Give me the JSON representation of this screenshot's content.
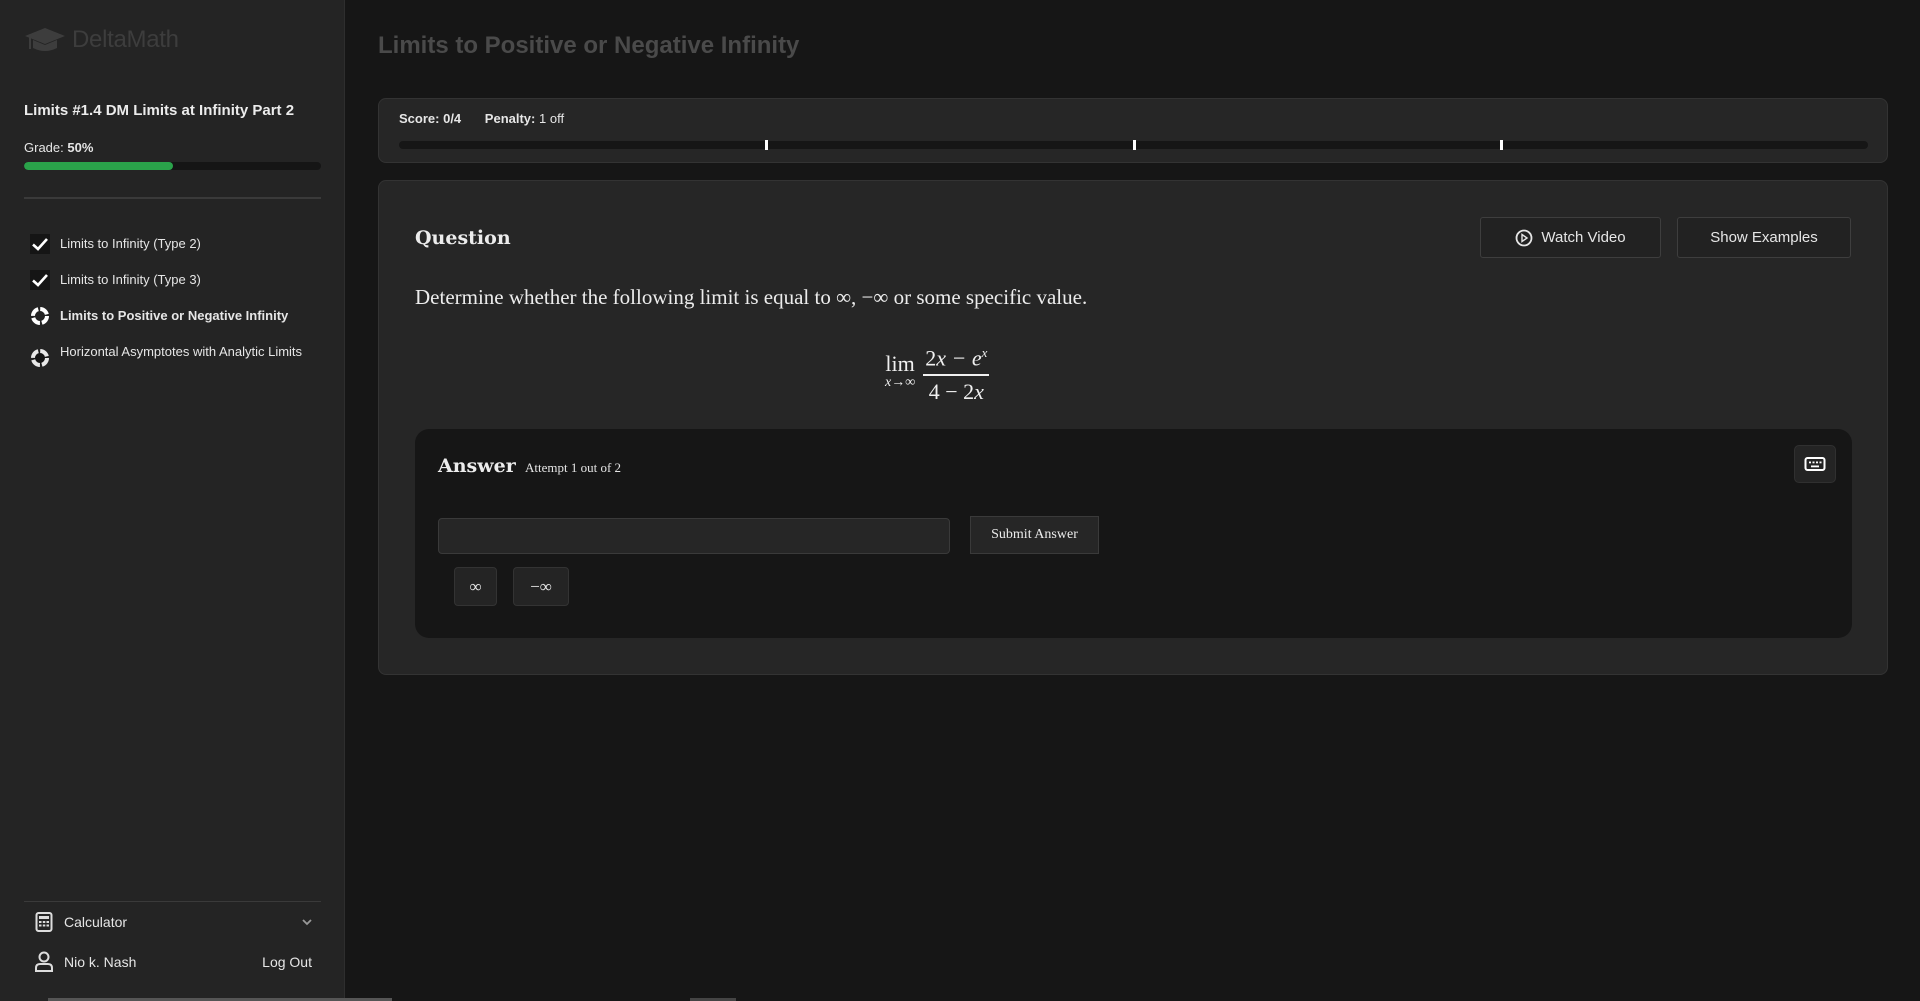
{
  "brand": {
    "name": "DeltaMath",
    "logo_icon": "graduation-cap-icon"
  },
  "sidebar": {
    "assignment_title": "Limits #1.4 DM Limits at Infinity Part 2",
    "grade_label": "Grade:",
    "grade_value": "50%",
    "grade_fraction": 0.5,
    "grade_color": "#2aa24a",
    "skills": [
      {
        "label": "Limits to Infinity (Type 2)",
        "status": "complete",
        "icon": "checkmark-icon"
      },
      {
        "label": "Limits to Infinity (Type 3)",
        "status": "complete",
        "icon": "checkmark-icon"
      },
      {
        "label": "Limits to Positive or Negative Infinity",
        "status": "in-progress",
        "icon": "progress-ring-icon",
        "active": true
      },
      {
        "label": "Horizontal Asymptotes with Analytic Limits",
        "status": "in-progress",
        "icon": "progress-ring-icon"
      }
    ],
    "calculator_label": "Calculator",
    "user_name": "Nio k. Nash",
    "logout_label": "Log Out"
  },
  "main": {
    "page_title": "Limits to Positive or Negative Infinity",
    "score": {
      "score_label": "Score:",
      "score_value": "0/4",
      "penalty_label": "Penalty:",
      "penalty_value": "1 off",
      "earned": 0,
      "total": 4
    },
    "question": {
      "heading": "Question",
      "watch_video_label": "Watch Video",
      "show_examples_label": "Show Examples",
      "prompt": "Determine whether the following limit is equal to ∞, −∞ or some specific value.",
      "math": {
        "lim": "lim",
        "subscript": "x→∞",
        "numerator_a": "2",
        "numerator_b": "x",
        "numerator_c": " − e",
        "numerator_exp": "x",
        "denominator_a": "4 − 2",
        "denominator_b": "x"
      }
    },
    "answer": {
      "heading": "Answer",
      "attempt_text": "Attempt 1 out of 2",
      "input_value": "",
      "input_placeholder": "",
      "submit_label": "Submit Answer",
      "symbol_buttons": [
        "∞",
        "−∞"
      ],
      "keyboard_icon": "keyboard-icon"
    }
  }
}
